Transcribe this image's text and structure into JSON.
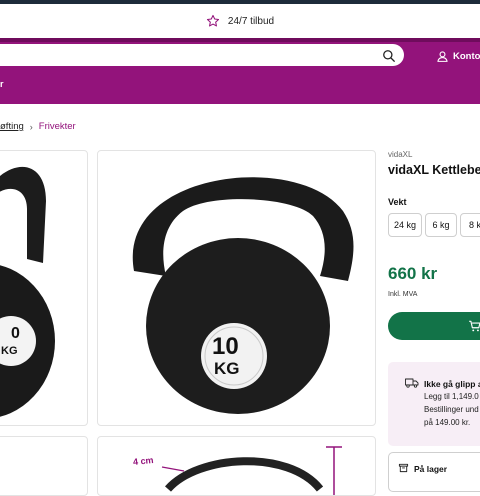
{
  "promo": {
    "text": "24/7 tilbud"
  },
  "header": {
    "account_label": "Konto",
    "menu_label": "r"
  },
  "breadcrumb": {
    "parent": "øfting",
    "current": "Frivekter"
  },
  "gallery": {
    "main_label_top": "10",
    "main_label_bottom": "KG",
    "left_label_top": "0",
    "left_label_bottom": "KG",
    "dimension_label": "4 cm"
  },
  "product": {
    "brand": "vidaXL",
    "title": "vidaXL Kettlebe",
    "weight_label": "Vekt",
    "weights": [
      "24 kg",
      "6 kg",
      "8 k"
    ],
    "price": "660 kr",
    "vat_note": "Inkl. MVA"
  },
  "delivery": {
    "title": "Ikke gå glipp a",
    "lines": [
      "Legg til 1,149.0",
      "Bestillinger und",
      "på 149.00 kr."
    ]
  },
  "stock": {
    "label": "På lager"
  },
  "colors": {
    "brand_purple": "#93137b",
    "price_green": "#127348",
    "navy": "#1d2b3a"
  }
}
